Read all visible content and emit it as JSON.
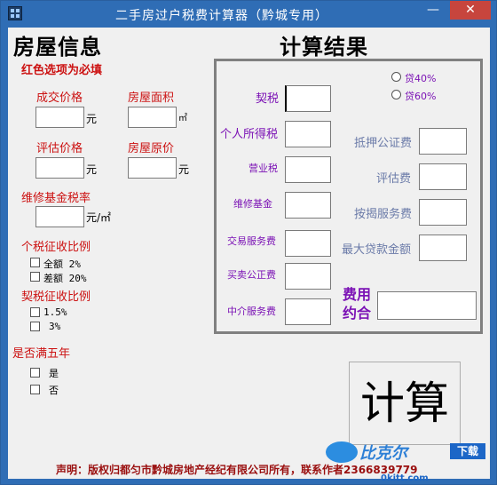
{
  "window": {
    "title": "二手房过户税费计算器（黔城专用）",
    "close_label": "✕",
    "min_label": "—"
  },
  "left": {
    "heading": "房屋信息",
    "required_note": "红色选项为必填",
    "deal_price_label": "成交价格",
    "area_label": "房屋面积",
    "unit_yuan": "元",
    "unit_sqm": "㎡",
    "assess_price_label": "评估价格",
    "orig_price_label": "房屋原价",
    "fund_rate_label": "维修基金税率",
    "unit_yuan_per_sqm": "元/㎡",
    "income_tax_label": "个税征收比例",
    "income_tax_options": [
      "全额  2%",
      "差额 20%"
    ],
    "deed_tax_label": "契税征收比例",
    "deed_tax_options": [
      "1.5%",
      "3%"
    ],
    "five_years_label": "是否满五年",
    "five_years_options": [
      "是",
      "否"
    ]
  },
  "right": {
    "heading": "计算结果",
    "loan_options": [
      "贷40%",
      "贷60%"
    ],
    "deed_tax": "契税",
    "income_tax": "个人所得税",
    "business_tax": "营业税",
    "maintenance_fund": "维修基金",
    "transaction_fee": "交易服务费",
    "notary_fee": "买卖公正费",
    "agency_fee": "中介服务费",
    "mortgage_notary_fee": "抵押公证费",
    "assess_fee": "评估费",
    "mortgage_service_fee": "按揭服务费",
    "max_loan": "最大贷款金额",
    "total_fee_label": "费用约合",
    "calc_button": "计算"
  },
  "footer": {
    "text": "声明：版权归都匀市黔城房地产经纪有限公司所有，联系作者2366839779",
    "watermark": "比克尔",
    "download": "下载",
    "site": "0kitt.com"
  },
  "colors": {
    "required_red": "#cc1111",
    "result_purple": "#7b12b5",
    "optional_gray": "#6a7aa8",
    "title_blue": "#2f6db5",
    "close_red": "#c7453d"
  }
}
